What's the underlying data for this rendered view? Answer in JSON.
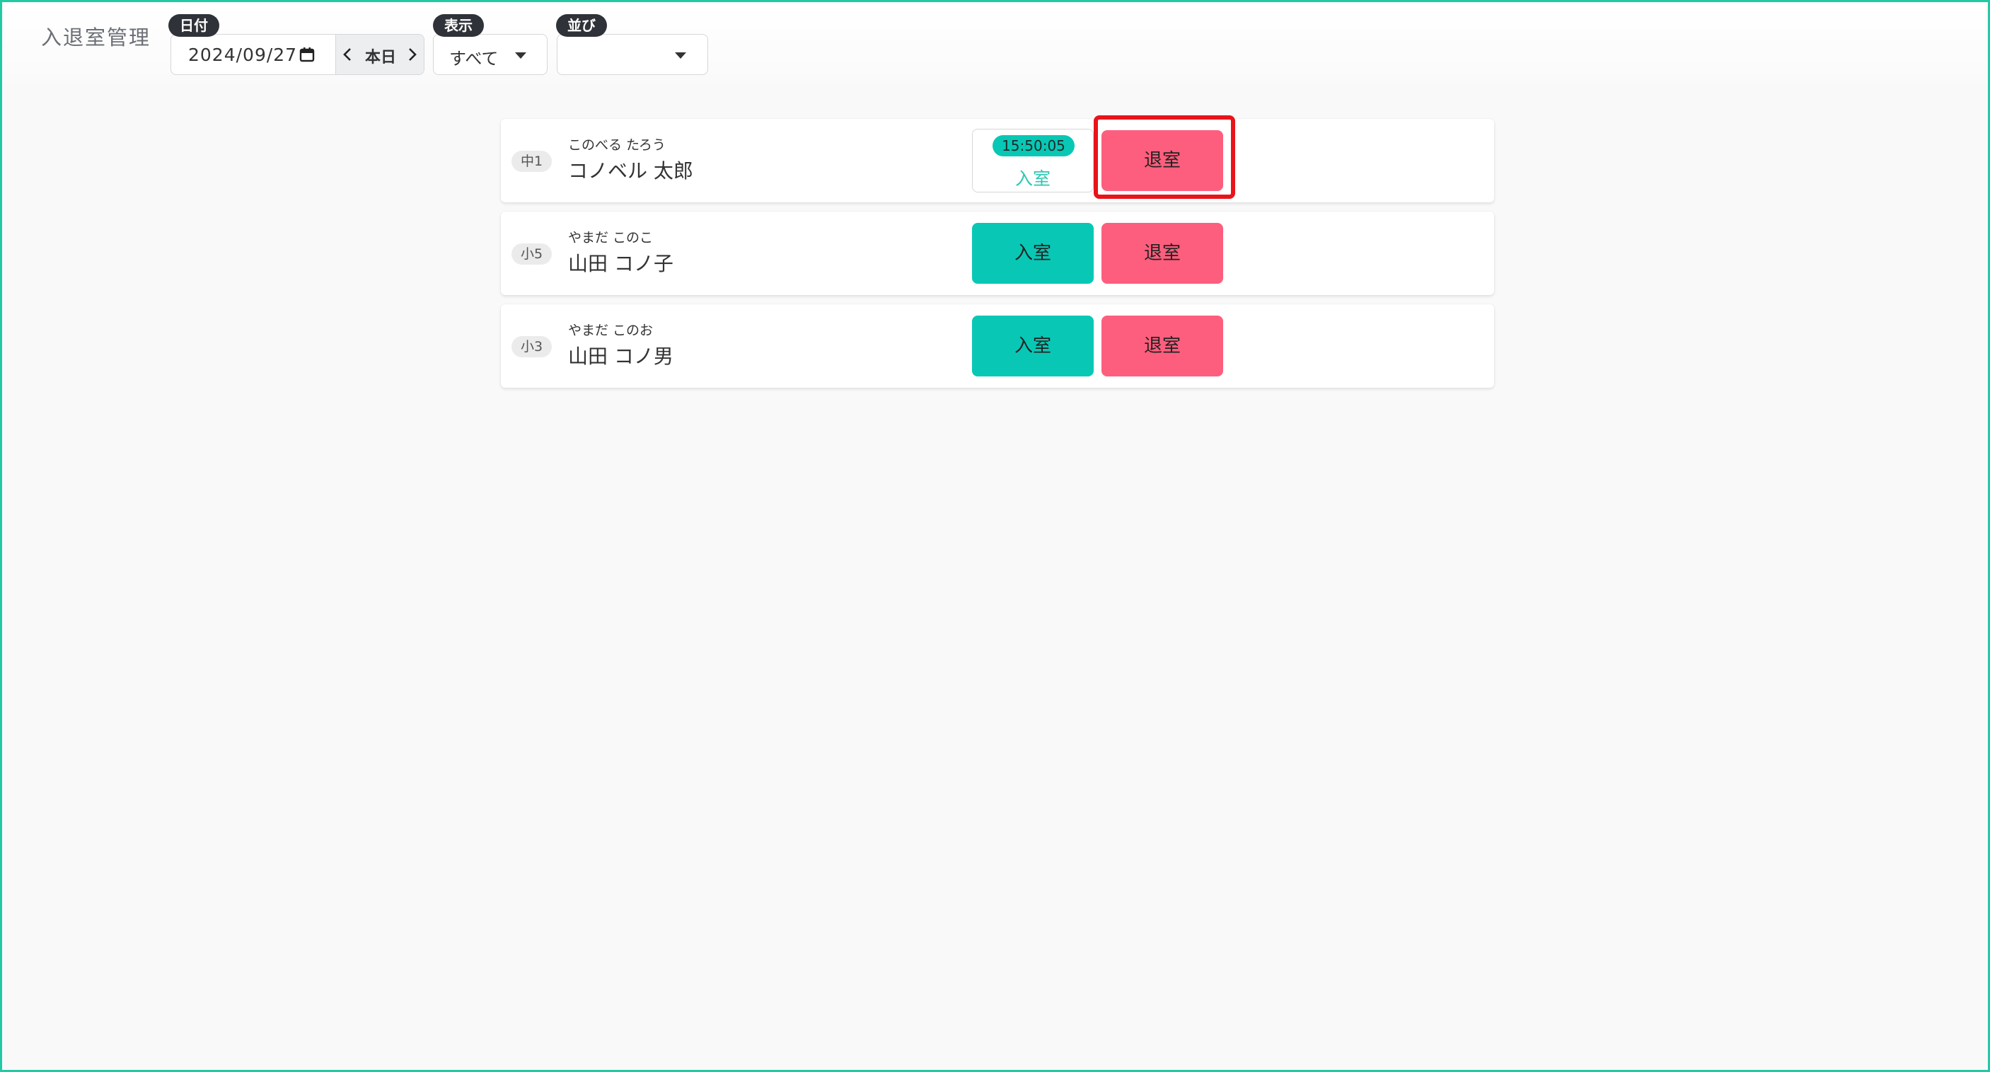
{
  "app": {
    "title": "入退室管理"
  },
  "filters": {
    "date": {
      "badge": "日付",
      "value": "2024/09/27",
      "today_label": "本日"
    },
    "display": {
      "badge": "表示",
      "value": "すべて"
    },
    "sort": {
      "badge": "並び",
      "value": ""
    }
  },
  "students": [
    {
      "grade": "中1",
      "kana": "このべる たろう",
      "name": "コノベル 太郎",
      "status": "entered",
      "entry_time": "15:50:05",
      "entered_label": "入室",
      "exit_label": "退室"
    },
    {
      "grade": "小5",
      "kana": "やまだ このこ",
      "name": "山田 コノ子",
      "status": "none",
      "enter_label": "入室",
      "exit_label": "退室"
    },
    {
      "grade": "小3",
      "kana": "やまだ このお",
      "name": "山田 コノ男",
      "status": "none",
      "enter_label": "入室",
      "exit_label": "退室"
    }
  ],
  "colors": {
    "enter": "#08c8b5",
    "exit": "#fe5e7d",
    "highlight": "#e8141a",
    "badge": "#2f3238"
  },
  "icons": [
    "calendar-icon",
    "chevron-left-icon",
    "chevron-right-icon",
    "caret-down-icon"
  ]
}
